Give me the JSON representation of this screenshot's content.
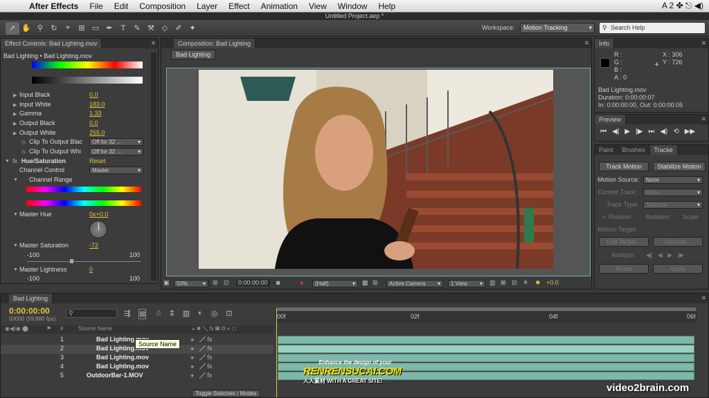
{
  "menubar": {
    "app_name": "After Effects",
    "items": [
      "File",
      "Edit",
      "Composition",
      "Layer",
      "Effect",
      "Animation",
      "View",
      "Window",
      "Help"
    ],
    "status_icons": "A 2  ✤  ⎋  ◀)"
  },
  "window_title": "Untitled Project.aep *",
  "toolbar": {
    "workspace_label": "Workspace:",
    "workspace_value": "Motion Tracking",
    "search_placeholder": "Search Help"
  },
  "effect_controls": {
    "tab_label": "Effect Controls: Bad Lighting.mov",
    "breadcrumb": "Bad Lighting • Bad Lighting.mov",
    "levels": [
      {
        "label": "Input Black",
        "value": "0.0"
      },
      {
        "label": "Input White",
        "value": "183.0"
      },
      {
        "label": "Gamma",
        "value": "1.33"
      },
      {
        "label": "Output Black",
        "value": "0.0"
      },
      {
        "label": "Output White",
        "value": "255.0"
      }
    ],
    "clip_black_label": "Clip To Output Blac",
    "clip_white_label": "Clip To Output Whi",
    "clip_value": "Off for 32 ...",
    "hue_sat_label": "Hue/Saturation",
    "reset_label": "Reset",
    "channel_control_label": "Channel Control",
    "channel_control_value": "Master",
    "channel_range_label": "Channel Range",
    "master_hue_label": "Master Hue",
    "master_hue_value": "0x+0.0",
    "master_sat_label": "Master Saturation",
    "master_sat_value": "-72",
    "master_light_label": "Master Lightness",
    "master_light_value": "0",
    "slider_min": "-100",
    "slider_max": "100"
  },
  "composition": {
    "tab_label": "Composition: Bad Lighting",
    "sub_tab": "Bad Lighting",
    "zoom": "50%",
    "timecode": "0:00:00:00",
    "resolution": "(Half)",
    "camera": "Active Camera",
    "view": "1 View",
    "exposure": "+0.0"
  },
  "info": {
    "tab_label": "Info",
    "r": "R :",
    "g": "G :",
    "b": "B :",
    "a": "A : 0",
    "x": "X : 306",
    "y": "Y : 726",
    "file": "Bad Lighting.mov",
    "duration": "Duration: 0:00:00:07",
    "in_out": "In: 0:00:00:00, Out: 0:00:00:05"
  },
  "preview": {
    "tab_label": "Preview"
  },
  "tracker": {
    "tabs": [
      "Paint",
      "Brushes",
      "Tracke"
    ],
    "track_motion": "Track Motion",
    "stabilize_motion": "Stabilize Motion",
    "motion_source_label": "Motion Source:",
    "motion_source_value": "None",
    "current_track_label": "Current Track:",
    "current_track_value": "None",
    "track_type_label": "Track Type:",
    "track_type_value": "Stabilize",
    "position": "Position",
    "rotation": "Rotation",
    "scale": "Scale",
    "motion_target": "Motion Target:",
    "edit_target": "Edit Target...",
    "options": "Options...",
    "analyze": "Analyze:",
    "reset": "Reset",
    "apply": "Apply"
  },
  "timeline": {
    "tab_label": "Bad Lighting",
    "timecode": "0:00:00:00",
    "fps": "00000 (59.880 fps)",
    "source_name_header": "Source Name",
    "tooltip": "Source Name",
    "ruler": [
      "00f",
      "02f",
      "04f",
      "06f"
    ],
    "toggle_label": "Toggle Switches / Modes",
    "layers": [
      {
        "num": "1",
        "name": "Bad Lighting.mov"
      },
      {
        "num": "2",
        "name": "Bad Lighting.mov"
      },
      {
        "num": "3",
        "name": "Bad Lighting.mov"
      },
      {
        "num": "4",
        "name": "Bad Lighting.mov"
      },
      {
        "num": "5",
        "name": "OutdoorBar-1.MOV"
      }
    ]
  },
  "watermarks": {
    "renrensucai_top": "Enhance the design of your",
    "renrensucai": "RENRENSUCAI.COM",
    "renrensucai_bottom": "人人素材 WITH A GREAT SITE!",
    "video2brain": "video2brain.com"
  }
}
